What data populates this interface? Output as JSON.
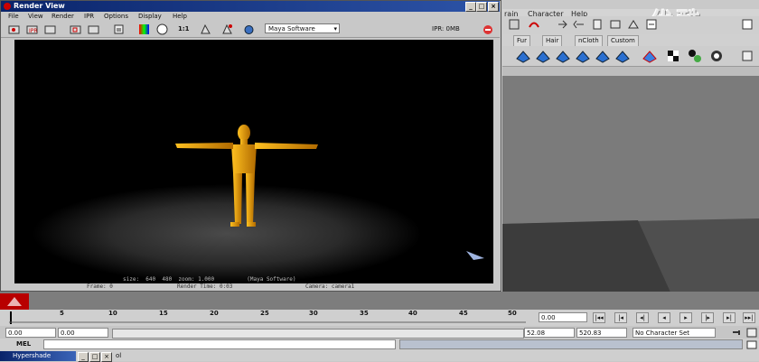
{
  "maya": {
    "menu": [
      "rain",
      "Character",
      "Help"
    ],
    "watermark": "优酷",
    "shelf_tabs": [
      "Fur",
      "Hair",
      "nCloth",
      "Custom"
    ]
  },
  "render_view": {
    "title": "Render View",
    "menu": [
      "File",
      "View",
      "Render",
      "IPR",
      "Options",
      "Display",
      "Help"
    ],
    "ratio_label": "1:1",
    "renderer": "Maya Software",
    "ipr_label": "IPR: 0MB",
    "info_line1": "size:  640  480  zoom: 1.000          (Maya Software)",
    "info_line2_left": "Frame: 0",
    "info_line2_mid": "Render Time: 0:03",
    "info_line2_right": "Camera: camera1"
  },
  "timeline": {
    "ticks": [
      "5",
      "10",
      "15",
      "20",
      "25",
      "30",
      "35",
      "40",
      "45",
      "50"
    ],
    "current_frame": "0.00",
    "range_start": "0.00",
    "range_start2": "0.00",
    "range_end": "52.08",
    "range_end2": "520.83",
    "character_set": "No Character Set",
    "mel_label": "MEL",
    "hypershade_title": "Hypershade",
    "trailing_text": "ol"
  },
  "colors": {
    "title_bar": "#0a246a",
    "render_bg": "#000000",
    "figure": "#e8a810"
  }
}
